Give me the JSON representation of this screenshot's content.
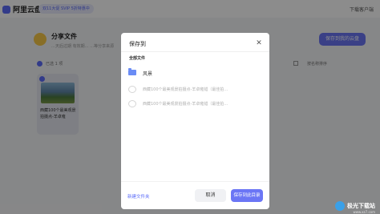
{
  "app": {
    "logo_text": "阿里云盘",
    "vip_text": "双11大促 SVIP 5折特惠中",
    "download_link": "下载客户端"
  },
  "share": {
    "title": "分享文件",
    "meta": "…天后过期  有效期…  …等分享来源",
    "save_button": "保存到我的云盘",
    "selected_text": "已选 1 项",
    "sort_label": "按名称排序"
  },
  "file_card": {
    "name": "西藏100个最美观景拍摄点-羊卓雍"
  },
  "dialog": {
    "title": "保存到",
    "all_files": "全部文件",
    "folders": [
      {
        "label": "风景",
        "enabled": true
      },
      {
        "label": "西藏100个最美观景拍摄点-羊卓雍错（最佳拍…",
        "enabled": false
      },
      {
        "label": "西藏100个最美观景拍摄点-羊卓雍错（最佳拍…",
        "enabled": false
      }
    ],
    "new_folder": "新建文件夹",
    "cancel": "取消",
    "confirm": "保存到此目录"
  },
  "watermark": {
    "text": "极光下载站",
    "url": "www.xz7.com"
  },
  "colors": {
    "accent": "#6b76f5",
    "folder": "#6a8cf5"
  }
}
